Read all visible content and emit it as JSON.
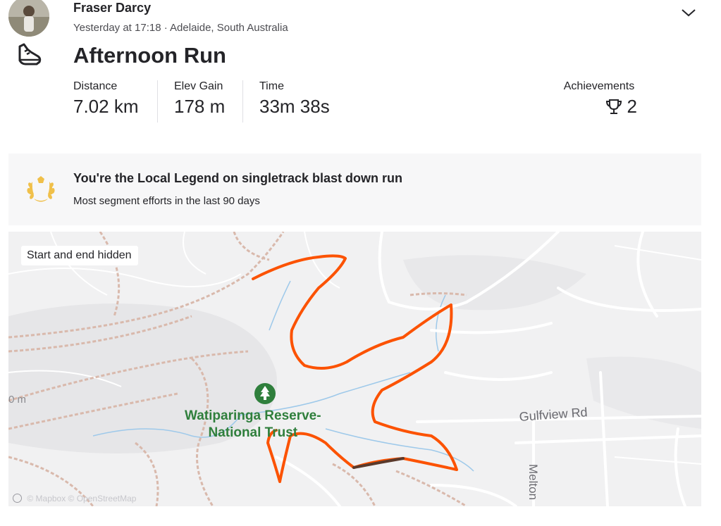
{
  "athlete": {
    "name": "Fraser Darcy"
  },
  "activity": {
    "meta": "Yesterday at 17:18 · Adelaide, South Australia",
    "title": "Afternoon Run",
    "sport_icon": "shoe-icon"
  },
  "stats": [
    {
      "label": "Distance",
      "value": "7.02 km"
    },
    {
      "label": "Elev Gain",
      "value": "178 m"
    },
    {
      "label": "Time",
      "value": "33m 38s"
    }
  ],
  "achievements": {
    "label": "Achievements",
    "count": "2",
    "icon": "trophy-icon"
  },
  "local_legend": {
    "title": "You're the Local Legend on singletrack blast down run",
    "subtitle": "Most segment efforts in the last 90 days",
    "icon": "laurel-icon",
    "accent": "#f0c04a"
  },
  "map": {
    "privacy_badge": "Start and end hidden",
    "park_name_line1": "Watiparinga Reserve-",
    "park_name_line2": "National Trust",
    "road_1": "Gulfview Rd",
    "road_2": "Melton",
    "elevation_fragment": "0 m",
    "attribution": "© Mapbox © OpenStreetMap",
    "route_color": "#fc5200",
    "park_color": "#2f7f3c"
  }
}
